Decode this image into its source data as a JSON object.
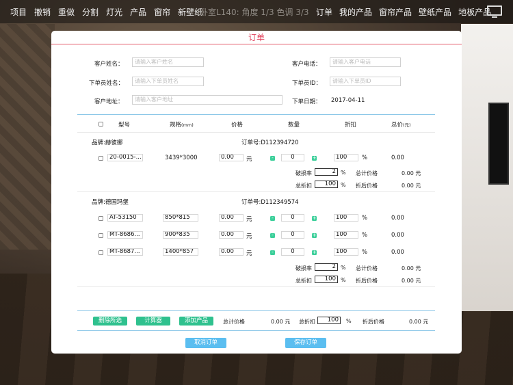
{
  "topbar": {
    "left": [
      "项目",
      "撤销",
      "重做",
      "分割",
      "灯光",
      "产品",
      "窗帘",
      "新壁纸"
    ],
    "center": "卧室L140: 角度 1/3 色调 3/3",
    "right": [
      "订单",
      "我的产品",
      "窗帘产品",
      "壁纸产品",
      "地板产品"
    ]
  },
  "modal": {
    "title": "订单",
    "form": {
      "customer_name_label": "客户姓名：",
      "customer_name_placeholder": "请输入客户姓名",
      "customer_phone_label": "客户电话：",
      "customer_phone_placeholder": "请输入客户电话",
      "orderer_name_label": "下单员姓名：",
      "orderer_name_placeholder": "请输入下单员姓名",
      "orderer_id_label": "下单员ID：",
      "orderer_id_placeholder": "请输入下单员ID",
      "address_label": "客户地址：",
      "address_placeholder": "请输入客户地址",
      "date_label": "下单日期：",
      "date_value": "2017-04-11"
    },
    "columns": {
      "model": "型号",
      "spec": "规格",
      "spec_unit": "(mm)",
      "price": "价格",
      "qty": "数量",
      "discount": "折扣",
      "total": "总价",
      "total_unit": "(元)"
    },
    "groups": [
      {
        "brand": "品牌:赫彼娜",
        "order_no": "订单号:D112394720",
        "items": [
          {
            "model": "20-0015-...",
            "spec": "3439*3000",
            "price": "0.00",
            "price_unit": "元",
            "qty": "0",
            "discount": "100",
            "discount_unit": "%",
            "total": "0.00"
          }
        ],
        "loss_label": "破损率",
        "loss_value": "2",
        "loss_unit": "%",
        "sum_label": "总计价格",
        "sum_value": "0.00 元",
        "disc_label": "总折扣",
        "disc_value": "100",
        "disc_unit": "%",
        "after_label": "折后价格",
        "after_value": "0.00 元"
      },
      {
        "brand": "品牌:德国玛堡",
        "order_no": "订单号:D112349574",
        "items": [
          {
            "model": "AT-53150",
            "spec": "850*815",
            "price": "0.00",
            "price_unit": "元",
            "qty": "0",
            "discount": "100",
            "discount_unit": "%",
            "total": "0.00"
          },
          {
            "model": "MT-8686...",
            "spec": "900*835",
            "price": "0.00",
            "price_unit": "元",
            "qty": "0",
            "discount": "100",
            "discount_unit": "%",
            "total": "0.00"
          },
          {
            "model": "MT-8687...",
            "spec": "1400*857",
            "price": "0.00",
            "price_unit": "元",
            "qty": "0",
            "discount": "100",
            "discount_unit": "%",
            "total": "0.00"
          }
        ],
        "loss_label": "破损率",
        "loss_value": "2",
        "loss_unit": "%",
        "sum_label": "总计价格",
        "sum_value": "0.00 元",
        "disc_label": "总折扣",
        "disc_value": "100",
        "disc_unit": "%",
        "after_label": "折后价格",
        "after_value": "0.00 元"
      }
    ],
    "footer": {
      "delete_selected": "删除所选",
      "calculator": "计算器",
      "add_product": "添加产品",
      "total_label": "总计价格",
      "total_value": "0.00 元",
      "discount_label": "总折扣",
      "discount_value": "100",
      "discount_unit": "%",
      "after_label": "折后价格",
      "after_value": "0.00 元",
      "cancel": "取消订单",
      "save": "保存订单"
    }
  },
  "colors": {
    "accent_red": "#e0405a",
    "green": "#2fc18e",
    "blue": "#5bbef0"
  }
}
